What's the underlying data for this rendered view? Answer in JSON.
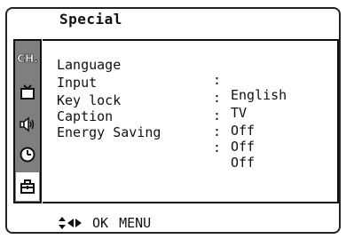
{
  "menu": {
    "title": "Special",
    "sidebar": {
      "items": [
        {
          "label": "CH.",
          "icon": "channel-icon"
        },
        {
          "icon": "tv-icon"
        },
        {
          "icon": "speaker-icon"
        },
        {
          "icon": "clock-icon"
        },
        {
          "icon": "toolbox-icon",
          "selected": true
        }
      ]
    },
    "rows": [
      {
        "label": "Language",
        "colon": ":",
        "value": "English"
      },
      {
        "label": "Input",
        "colon": ":",
        "value": "TV"
      },
      {
        "label": "Key lock",
        "colon": ":",
        "value": "Off"
      },
      {
        "label": "Caption",
        "colon": ":",
        "value": "Off"
      },
      {
        "label": "Energy Saving",
        "colon": ":",
        "value": "Off"
      }
    ],
    "footer": {
      "ok": "OK",
      "menu": "MENU"
    }
  }
}
